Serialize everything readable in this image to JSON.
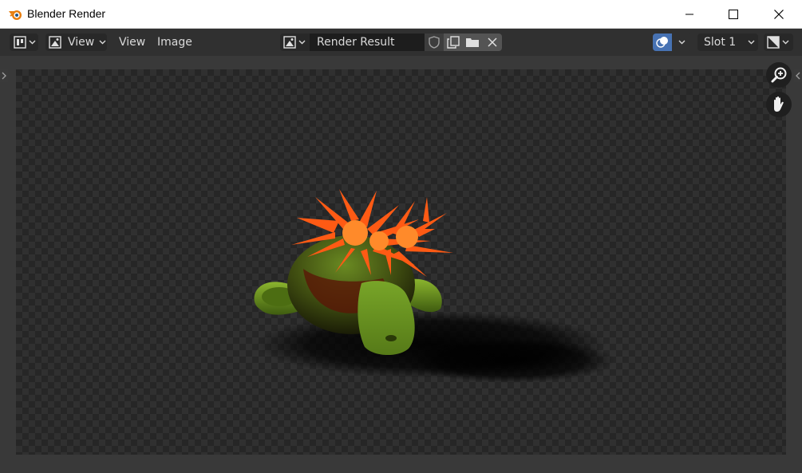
{
  "window": {
    "title": "Blender Render"
  },
  "header": {
    "view_menu_label": "View",
    "view_item_label": "View",
    "image_item_label": "Image",
    "image_name": "Render Result",
    "slot_label": "Slot 1"
  },
  "colors": {
    "accent": "#4772b3",
    "header_bg": "#303030",
    "viewport_bg": "#393939",
    "blender_orange": "#e87d0d"
  },
  "icons": {
    "app": "blender-logo-icon",
    "editor_type": "image-editor-icon",
    "mode": "image-view-icon",
    "browse": "image-browse-icon",
    "fake_user": "shield-icon",
    "duplicate": "duplicate-icon",
    "open": "folder-icon",
    "unlink": "close-icon",
    "overlay": "overlay-icon",
    "display_channels": "display-channels-icon",
    "zoom": "zoom-icon",
    "pan": "hand-icon"
  }
}
